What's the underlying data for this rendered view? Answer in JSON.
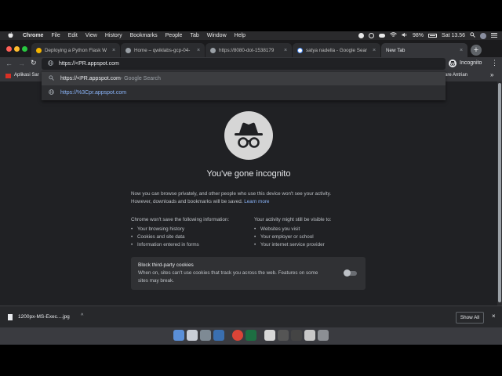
{
  "menubar": {
    "apple_icon": "apple-icon",
    "items": [
      "Chrome",
      "File",
      "Edit",
      "View",
      "History",
      "Bookmarks",
      "People",
      "Tab",
      "Window",
      "Help"
    ],
    "battery": "98%",
    "clock": "Sat 13.56"
  },
  "tabs": [
    {
      "title": "Deploying a Python Flask W",
      "favicon_color": "#f4b400"
    },
    {
      "title": "Home – qwiklabs-gcp-04-",
      "favicon_color": "#9aa0a6"
    },
    {
      "title": "https://8080-dot-1538179",
      "favicon_color": "#9aa0a6"
    },
    {
      "title": "satya nadella - Google Sear",
      "favicon_color": "#4285f4"
    },
    {
      "title": "New Tab",
      "favicon_color": ""
    }
  ],
  "toolbar": {
    "omnibox_value": "https://<PR.appspot.com",
    "profile_label": "Incognito"
  },
  "bookmarks": {
    "left": "Aplikasi Sar",
    "right": "are Antrian"
  },
  "suggestions": [
    {
      "text": "https://<PR.appspot.com",
      "suffix": " - Google Search",
      "icon": "search-icon"
    },
    {
      "text": "https://%3Cpr.appspot.com",
      "suffix": "",
      "icon": "globe-icon"
    }
  ],
  "page": {
    "heading": "You've gone incognito",
    "intro_line1": "Now you can browse privately, and other people who use this device won't see your activity.",
    "intro_line2": "However, downloads and bookmarks will be saved.",
    "learn_more": "Learn more",
    "left_title": "Chrome won't save the following information:",
    "left_items": [
      "Your browsing history",
      "Cookies and site data",
      "Information entered in forms"
    ],
    "right_title": "Your activity might still be visible to:",
    "right_items": [
      "Websites you visit",
      "Your employer or school",
      "Your internet service provider"
    ],
    "cookie_title": "Block third-party cookies",
    "cookie_desc1": "When on, sites can't use cookies that track you across the web. Features on some",
    "cookie_desc2": "sites may break."
  },
  "downloads": {
    "file": "1200px-MS-Exec....jpg",
    "show_all": "Show All"
  }
}
